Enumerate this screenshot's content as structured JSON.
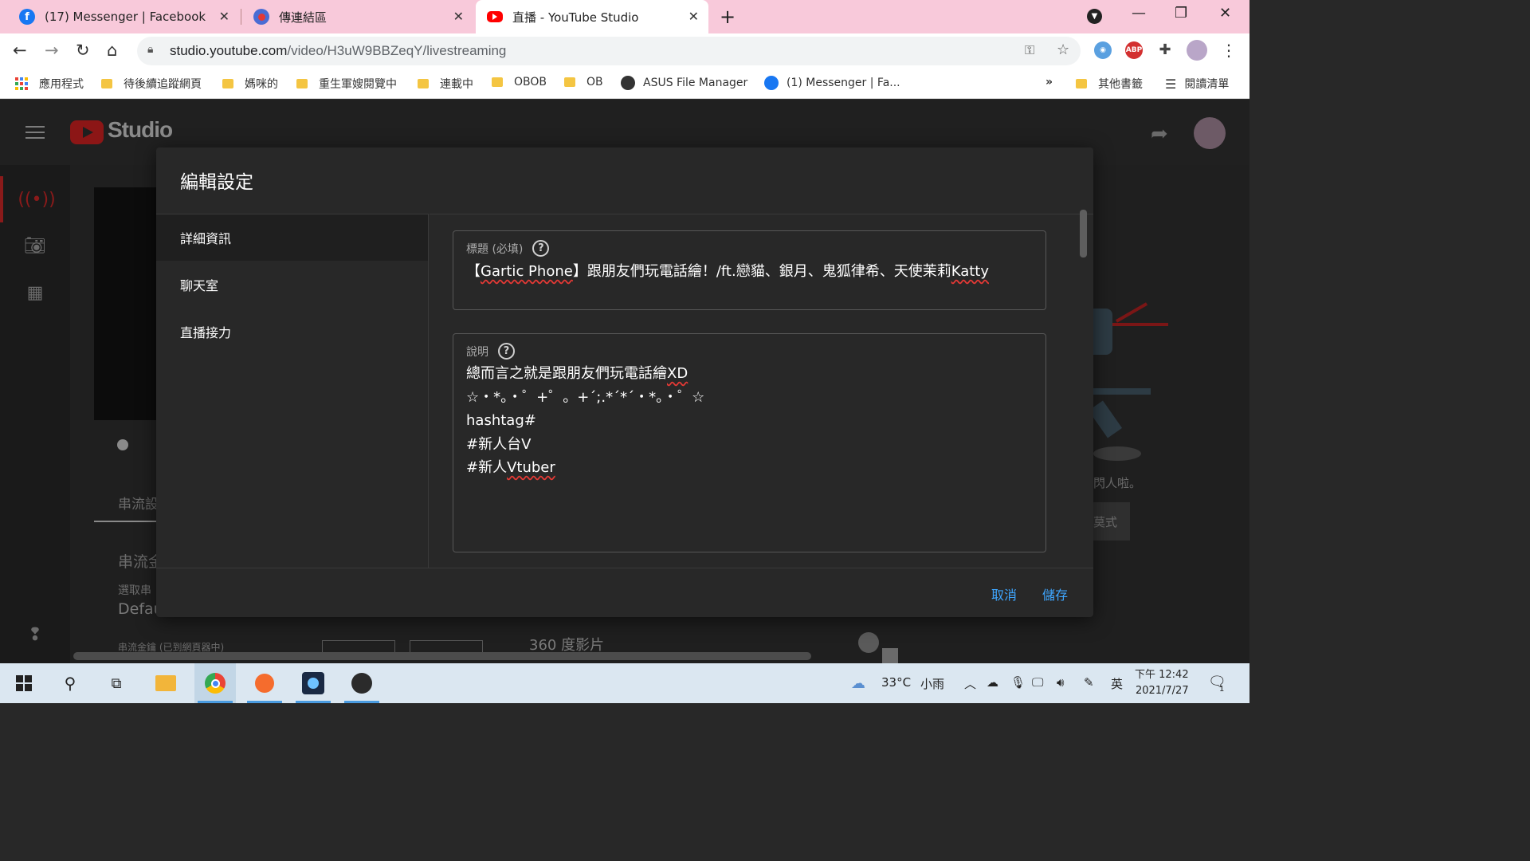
{
  "browser": {
    "tabs": [
      {
        "title": "(17) Messenger | Facebook",
        "active": false
      },
      {
        "title": "傳連結區",
        "active": false
      },
      {
        "title": "直播 - YouTube Studio",
        "active": true
      }
    ],
    "address": {
      "host": "studio.youtube.com",
      "path": "/video/H3uW9BBZeqY/livestreaming"
    },
    "extensions": {
      "abp": "ABP"
    },
    "bookmarks": [
      {
        "label": "應用程式",
        "kind": "apps"
      },
      {
        "label": "待後續追蹤網頁",
        "kind": "folder"
      },
      {
        "label": "媽咪的",
        "kind": "folder"
      },
      {
        "label": "重生軍嫂閱覽中",
        "kind": "folder"
      },
      {
        "label": "連載中",
        "kind": "folder"
      },
      {
        "label": "OBOB",
        "kind": "folder"
      },
      {
        "label": "OB",
        "kind": "folder"
      },
      {
        "label": "ASUS File Manager",
        "kind": "globe"
      },
      {
        "label": "(1) Messenger | Fa...",
        "kind": "facebook"
      }
    ],
    "bookmarks_more": "»",
    "other_bookmarks": "其他書籤",
    "reading_list": "閱讀清單"
  },
  "studio": {
    "logo_text": "Studio",
    "bg_stream_tab": "串流設",
    "bg_stream_key": "串流金",
    "bg_select": "選取串",
    "bg_default": "Defau",
    "bg_flash": "閃人啦。",
    "bg_mode": "莫式",
    "bg_360": "360 度影片",
    "bg_small": "串流金鑰 (已到網頁器中)"
  },
  "modal": {
    "title": "編輯設定",
    "nav": [
      {
        "label": "詳細資訊",
        "active": true
      },
      {
        "label": "聊天室",
        "active": false
      },
      {
        "label": "直播接力",
        "active": false
      }
    ],
    "title_field": {
      "label": "標題 (必填)",
      "help_icon": "?",
      "value_parts": [
        "【",
        "Gartic Phone",
        "】跟朋友們玩電話繪！/ft.戀貓、銀月、鬼狐律希、天使茉莉",
        "Katty"
      ]
    },
    "description_field": {
      "label": "說明",
      "help_icon": "?",
      "lines": [
        {
          "text": "總而言之就是跟朋友們玩電話繪",
          "flagged": "XD"
        },
        {
          "text": "☆・*。・゜+゜。+´;.*´*´・*。・゜☆",
          "flagged": ""
        },
        {
          "text": "hashtag#",
          "flagged": ""
        },
        {
          "text": "#新人台V",
          "flagged": ""
        },
        {
          "text": "#新人",
          "flagged": "Vtuber"
        }
      ]
    },
    "cancel_label": "取消",
    "save_label": "儲存"
  },
  "taskbar": {
    "weather_temp": "33°C",
    "weather_text": "小雨",
    "ime": "英",
    "time": "下午 12:42",
    "date": "2021/7/27",
    "notification_count": "1"
  },
  "colors": {
    "tabstrip": "#f8c9da",
    "modal_bg": "#282828",
    "accent_blue": "#3ea6ff",
    "taskbar": "#dbe7f1"
  }
}
